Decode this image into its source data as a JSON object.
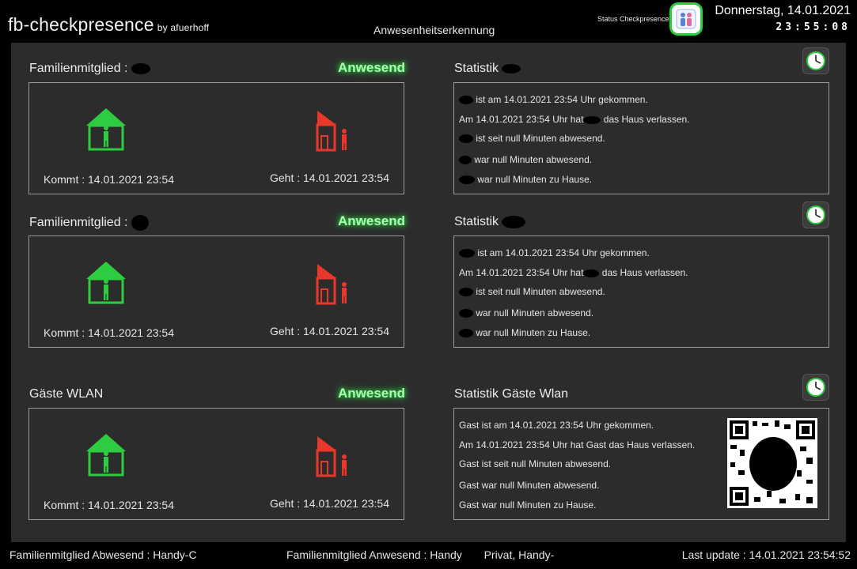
{
  "header": {
    "app_title": "fb-checkpresence",
    "app_by": "by afuerhoff",
    "subtitle": "Anwesenheitserkennung",
    "status_label": "Status Checkpresence",
    "date": "Donnerstag, 14.01.2021",
    "time": "23:55:08"
  },
  "members": [
    {
      "title": "Familienmitglied :",
      "status": "Anwesend",
      "kommt": "Kommt : 14.01.2021 23:54",
      "geht": "Geht : 14.01.2021 23:54",
      "stat_title": "Statistik",
      "stats": [
        "ist am 14.01.2021 23:54 Uhr gekommen.",
        "Am 14.01.2021 23:54 Uhr hat",
        "das Haus verlassen.",
        "ist seit null Minuten abwesend.",
        "war null Minuten abwesend.",
        "war null Minuten zu Hause."
      ]
    },
    {
      "title": "Familienmitglied :",
      "status": "Anwesend",
      "kommt": "Kommt : 14.01.2021 23:54",
      "geht": "Geht : 14.01.2021 23:54",
      "stat_title": "Statistik",
      "stats": [
        "ist am 14.01.2021 23:54 Uhr gekommen.",
        "Am 14.01.2021 23:54 Uhr hat",
        "das Haus verlassen.",
        "ist seit null Minuten abwesend.",
        "war null Minuten abwesend.",
        "war null Minuten zu Hause."
      ]
    },
    {
      "title": "Gäste WLAN",
      "status": "Anwesend",
      "kommt": "Kommt : 14.01.2021 23:54",
      "geht": "Geht : 14.01.2021 23:54",
      "stat_title": "Statistik Gäste Wlan",
      "stats": [
        "Gast ist am 14.01.2021 23:54 Uhr gekommen.",
        "Am 14.01.2021 23:54 Uhr hat Gast das Haus verlassen.",
        "Gast ist seit null Minuten abwesend.",
        "Gast war null Minuten abwesend.",
        "Gast war null Minuten zu Hause."
      ]
    }
  ],
  "footer": {
    "abwesend": "Familienmitglied Abwesend : Handy-C",
    "anwesend": "Familienmitglied Anwesend : Handy",
    "anwesend_tail": "Privat, Handy-",
    "last_update": "Last update : 14.01.2021 23:54:52"
  },
  "colors": {
    "present": "#2ecc40",
    "absent": "#e8382a",
    "glow": "#a8ffb0"
  }
}
